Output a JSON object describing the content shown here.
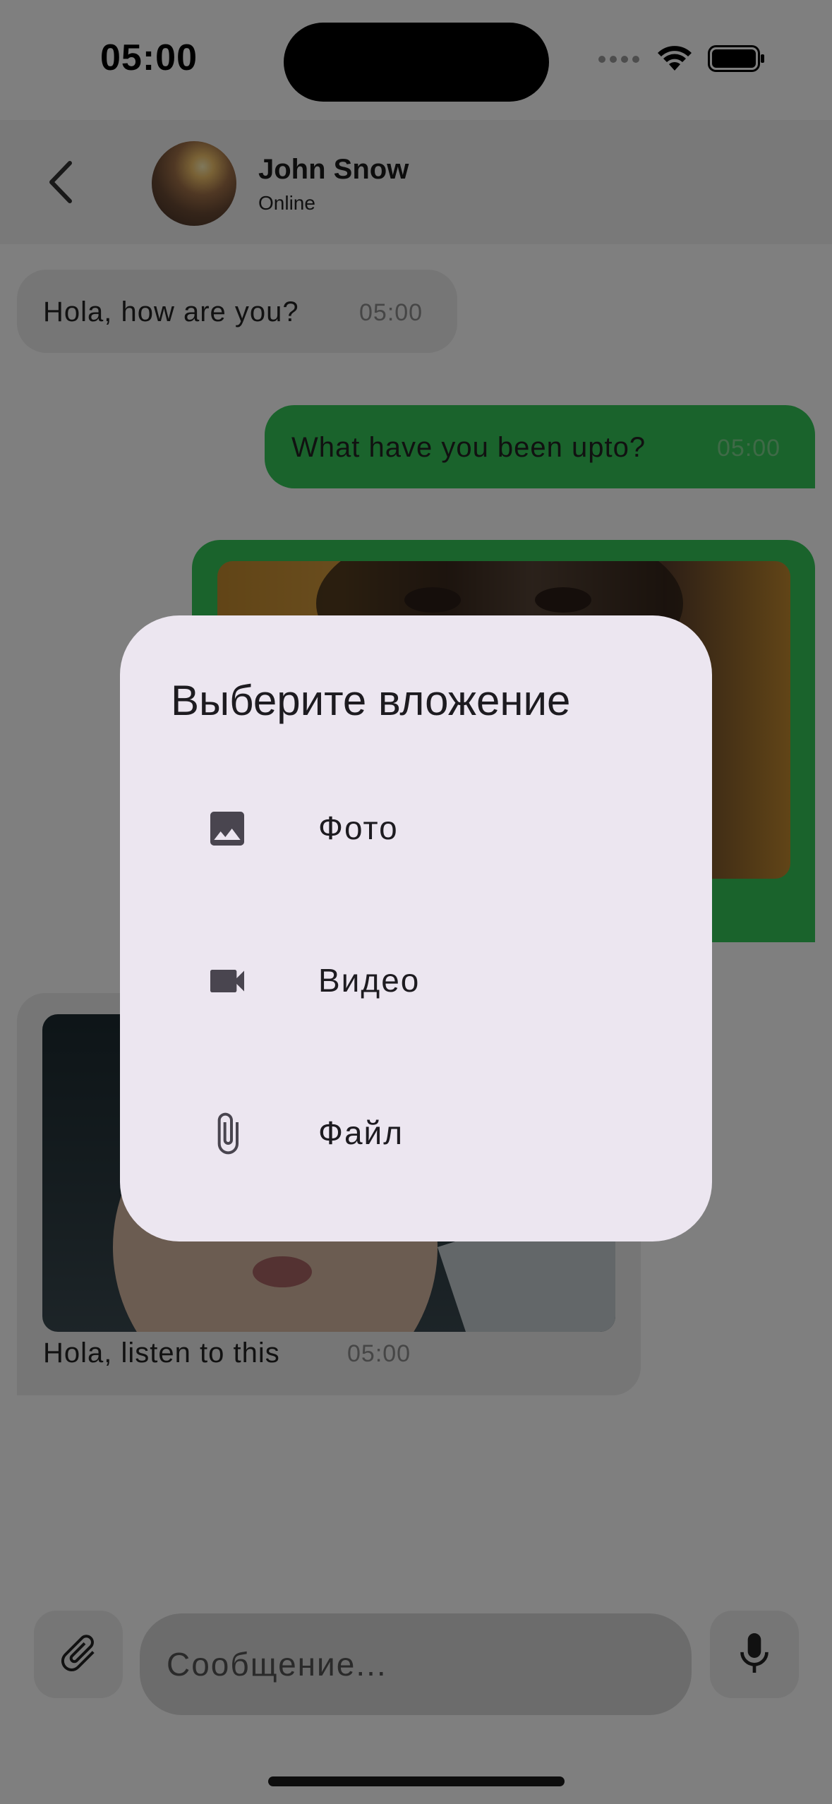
{
  "status_bar": {
    "time": "05:00",
    "icons": [
      "signal-dots-icon",
      "wifi-icon",
      "battery-icon"
    ]
  },
  "header": {
    "back_icon": "chevron-left-icon",
    "contact_name": "John Snow",
    "contact_status": "Online"
  },
  "messages": [
    {
      "direction": "incoming",
      "type": "text",
      "text": "Hola, how are you?",
      "time": "05:00"
    },
    {
      "direction": "outgoing",
      "type": "text",
      "text": "What have you been upto?",
      "time": "05:00"
    },
    {
      "direction": "outgoing",
      "type": "image",
      "text": "",
      "time": ""
    },
    {
      "direction": "incoming",
      "type": "image",
      "text": "Hola, listen to this",
      "time": "05:00"
    }
  ],
  "composer": {
    "attach_icon": "paperclip-icon",
    "placeholder": "Сообщение...",
    "mic_icon": "microphone-icon"
  },
  "dialog": {
    "title": "Выберите вложение",
    "options": [
      {
        "label": "Фото",
        "icon": "image-icon"
      },
      {
        "label": "Видео",
        "icon": "videocam-icon"
      },
      {
        "label": "Файл",
        "icon": "paperclip-icon"
      }
    ]
  },
  "colors": {
    "outgoing_bubble": "#34c759",
    "incoming_bubble": "#ececec",
    "dialog_background": "#ece6f0",
    "scrim": "#000000"
  }
}
